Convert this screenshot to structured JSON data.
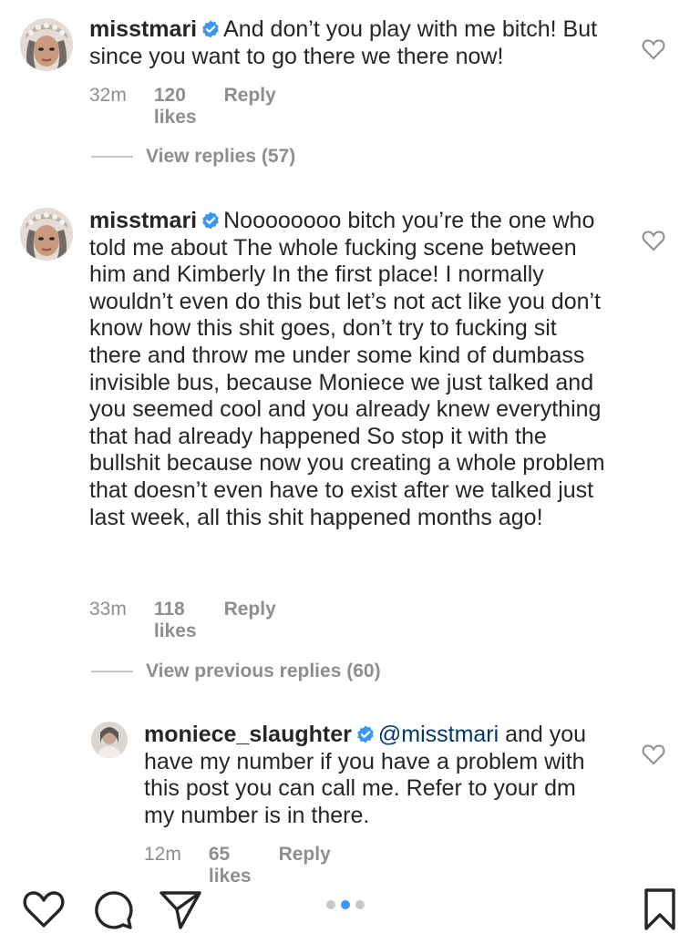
{
  "colors": {
    "text": "#262626",
    "muted": "#8e8e8e",
    "verified": "#3897f0",
    "mention": "#00376b",
    "dot_active": "#3897f0",
    "dot_inactive": "#c7c7c7"
  },
  "comments": [
    {
      "username": "misstmari",
      "verified": true,
      "text": "And don’t you play with me bitch! But since you want to go there  we there now!",
      "time": "32m",
      "likes": "120 likes",
      "reply_label": "Reply"
    },
    {
      "username": "misstmari",
      "verified": true,
      "text": "Noooooooo bitch you’re the one who told me about The whole fucking scene between him and Kimberly In the first place! I normally wouldn’t even do this but let’s not act like you don’t know how this shit goes, don’t try to fucking sit there and throw me under some kind of dumbass invisible bus, because Moniece we just talked and you seemed cool and you already knew everything that had already happened So stop it with the bullshit because now you creating a whole problem that doesn’t even have to exist after we talked just last week, all this shit happened months ago!",
      "time": "33m",
      "likes": "118 likes",
      "reply_label": "Reply"
    }
  ],
  "reply_toggles": [
    "View replies (57)",
    "View previous replies (60)"
  ],
  "replies": [
    {
      "username": "moniece_slaughter",
      "verified": true,
      "mention": "@misstmari",
      "text": " and you have my number if you have a problem with this post you can call me. Refer to your dm my number is in there.",
      "time": "12m",
      "likes": "65 likes",
      "reply_label": "Reply"
    }
  ],
  "bottom_bar": {
    "icons": [
      "heart-icon",
      "comment-icon",
      "share-icon",
      "bookmark-icon"
    ],
    "carousel_dots": 3,
    "carousel_active_index": 1
  }
}
